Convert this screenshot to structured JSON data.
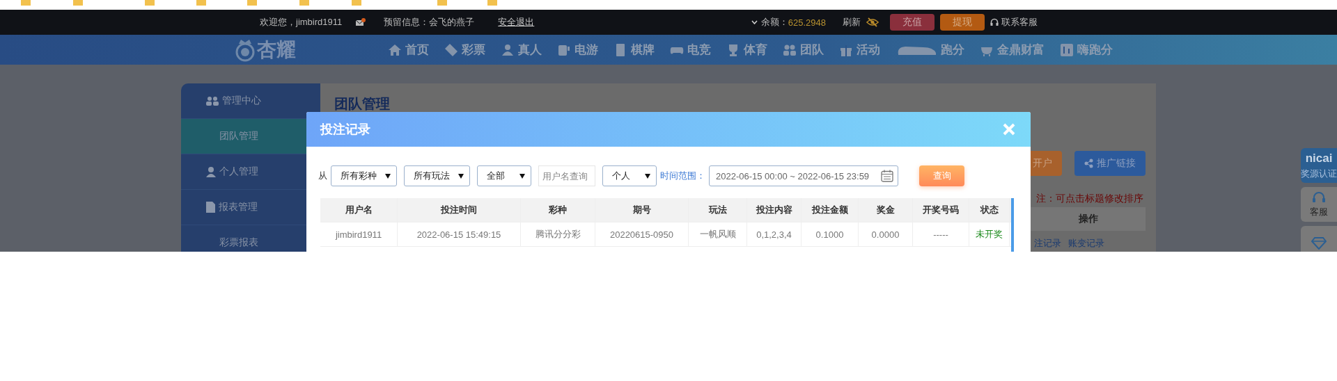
{
  "top_bar": {
    "welcome": "欢迎您，jimbird1911",
    "has_message": true,
    "reserved_info": "预留信息：会飞的燕子",
    "logout": "安全退出",
    "balance_label": "余额：",
    "balance": "625.2948",
    "refresh": "刷新",
    "balance_hidden": true,
    "deposit": "充值",
    "withdraw": "提现",
    "support": "联系客服"
  },
  "nav": {
    "logo": "杏耀",
    "items": [
      {
        "label": "首页"
      },
      {
        "label": "彩票"
      },
      {
        "label": "真人"
      },
      {
        "label": "电游"
      },
      {
        "label": "棋牌"
      },
      {
        "label": "电竞"
      },
      {
        "label": "体育"
      },
      {
        "label": "团队"
      },
      {
        "label": "活动"
      },
      {
        "label": "跑分"
      },
      {
        "label": "金鼎财富"
      },
      {
        "label": "嗨跑分"
      }
    ]
  },
  "sidebar": {
    "items": [
      {
        "label": "管理中心",
        "kind": "header",
        "selected": false
      },
      {
        "label": "团队管理",
        "kind": "sub",
        "selected": true
      },
      {
        "label": "个人管理",
        "kind": "header",
        "selected": false
      },
      {
        "label": "报表管理",
        "kind": "header",
        "selected": false
      },
      {
        "label": "彩票报表",
        "kind": "sub",
        "selected": false
      }
    ]
  },
  "page": {
    "title": "团队管理",
    "buttons": [
      {
        "label": "开户",
        "kind": "open"
      },
      {
        "label": "推广链接",
        "kind": "share"
      }
    ],
    "note": "注：可点击标题修改排序",
    "table_column": "操作",
    "row_links": [
      "注记录",
      "账变记录"
    ]
  },
  "modal": {
    "title": "投注记录",
    "from_label": "从",
    "filters": [
      {
        "kind": "select",
        "value": "所有彩种"
      },
      {
        "kind": "select",
        "value": "所有玩法"
      },
      {
        "kind": "select",
        "value": "全部"
      },
      {
        "kind": "input",
        "placeholder": "用户名查询"
      },
      {
        "kind": "select",
        "value": "个人"
      }
    ],
    "time_label": "时间范围：",
    "time_range": "2022-06-15 00:00 ~ 2022-06-15 23:59",
    "query": "查询",
    "columns": [
      "用户名",
      "投注时间",
      "彩种",
      "期号",
      "玩法",
      "投注内容",
      "投注金额",
      "奖金",
      "开奖号码",
      "状态"
    ],
    "rows": [
      [
        "jimbird1911",
        "2022-06-15 15:49:15",
        "腾讯分分彩",
        "20220615-0950",
        "一帆风顺",
        "0,1,2,3,4",
        "0.1000",
        "0.0000",
        "-----",
        "未开奖"
      ]
    ]
  },
  "float_buttons": [
    {
      "kind": "logo",
      "logo_text": "nicai",
      "label": "奖源认证"
    },
    {
      "kind": "headset",
      "label": "客服"
    },
    {
      "kind": "diamond"
    }
  ]
}
